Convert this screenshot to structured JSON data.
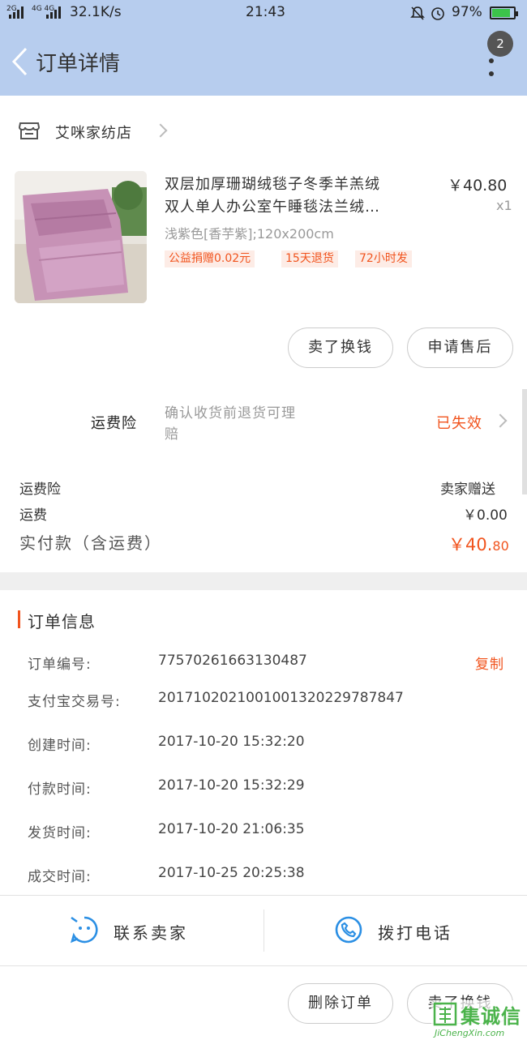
{
  "status_bar": {
    "network1": "2G",
    "network2": "4G 4G",
    "speed": "32.1K/s",
    "time": "21:43",
    "battery": "97%"
  },
  "header": {
    "title": "订单详情",
    "badge_count": "2"
  },
  "shop": {
    "name": "艾咪家纺店"
  },
  "product": {
    "title_line1": "双层加厚珊瑚绒毯子冬季羊羔绒",
    "title_line2": "双人单人办公室午睡毯法兰绒…",
    "price": "￥40.80",
    "quantity": "x1",
    "sku": "浅紫色[香芋紫];120x200cm",
    "tags": [
      "公益捐赠0.02元",
      "15天退货",
      "72小时发"
    ]
  },
  "actions_top": {
    "sell_label": "卖了换钱",
    "after_sale_label": "申请售后"
  },
  "insurance": {
    "label": "运费险",
    "desc_line1": "确认收货前退货可理",
    "desc_line2": "赔",
    "status": "已失效"
  },
  "costs": {
    "insurance_label": "运费险",
    "insurance_value": "卖家赠送",
    "shipping_label": "运费",
    "shipping_value": "￥0.00",
    "paid_label": "实付款（含运费）",
    "paid_value_main": "￥40.",
    "paid_value_cents": "80"
  },
  "order_info": {
    "section_title": "订单信息",
    "copy_label": "复制",
    "rows": [
      {
        "label": "订单编号:",
        "value": "77570261663130487"
      },
      {
        "label": "支付宝交易号:",
        "value": "2017102021001001320229787847"
      },
      {
        "label": "创建时间:",
        "value": "2017-10-20 15:32:20"
      },
      {
        "label": "付款时间:",
        "value": "2017-10-20 15:32:29"
      },
      {
        "label": "发货时间:",
        "value": "2017-10-20 21:06:35"
      },
      {
        "label": "成交时间:",
        "value": "2017-10-25 20:25:38"
      }
    ]
  },
  "contact": {
    "seller_label": "联系卖家",
    "phone_label": "拨打电话"
  },
  "actions_bottom": {
    "delete_label": "删除订单",
    "sell_label": "卖了换钱"
  },
  "watermark": {
    "cn": "集诚信",
    "en": "JiChengXin.com"
  },
  "colors": {
    "header_bg": "#b7cdee",
    "accent": "#f1541e",
    "icon_blue": "#2b8fe4"
  }
}
